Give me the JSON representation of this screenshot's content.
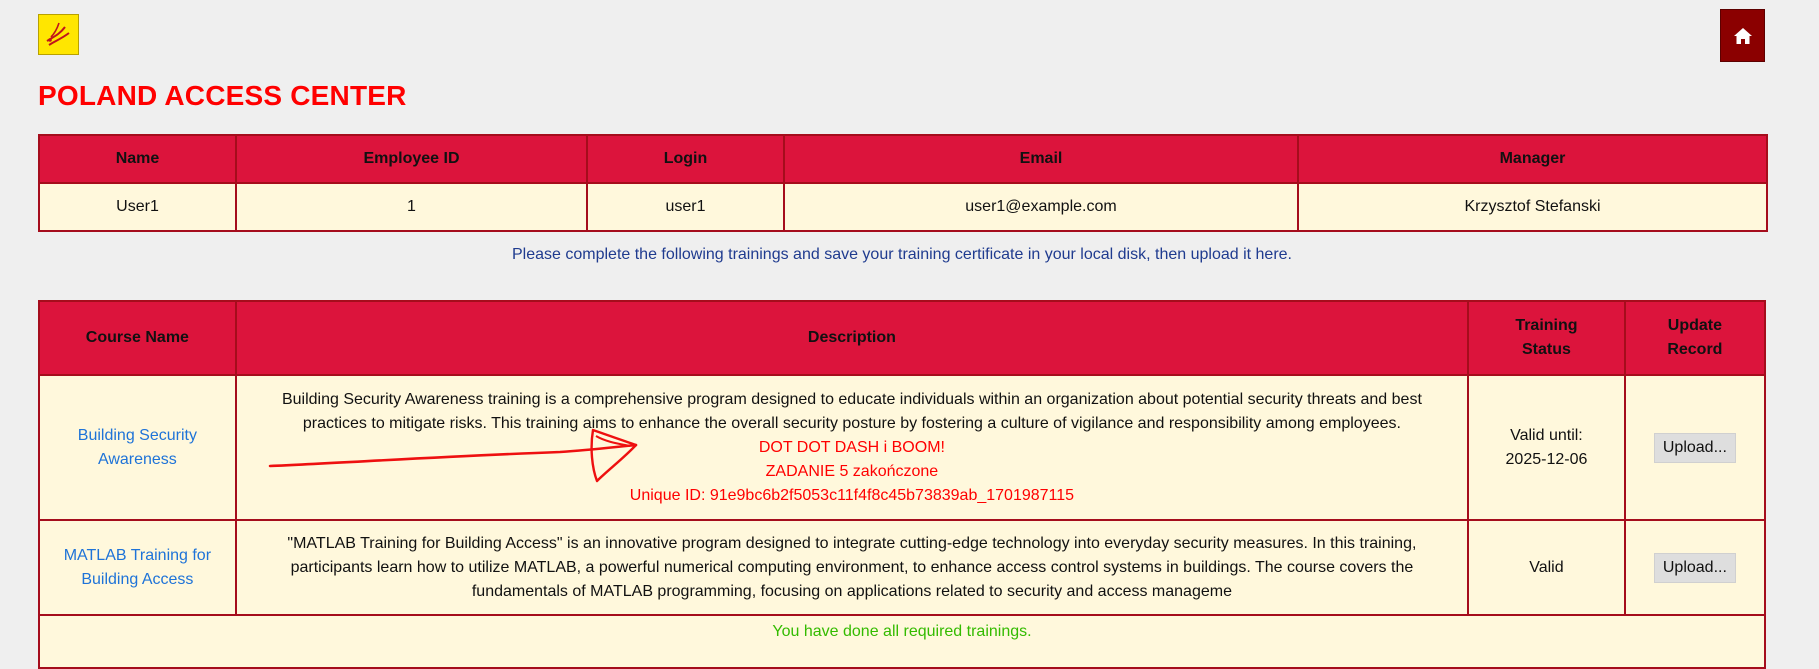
{
  "header": {
    "title": "POLAND ACCESS CENTER",
    "logo_icon": "bird-logo-icon",
    "home_icon": "home-icon"
  },
  "user_table": {
    "columns": [
      "Name",
      "Employee ID",
      "Login",
      "Email",
      "Manager"
    ],
    "row": {
      "name": "User1",
      "employee_id": "1",
      "login": "user1",
      "email": "user1@example.com",
      "manager": "Krzysztof Stefanski"
    }
  },
  "instruction": "Please complete the following trainings and save your training certificate in your local disk, then upload it here.",
  "course_table": {
    "columns": [
      "Course Name",
      "Description",
      "Training Status",
      "Update Record"
    ],
    "rows": [
      {
        "course_name": "Building Security Awareness",
        "description": "Building Security Awareness training is a comprehensive program designed to educate individuals within an organization about potential security threats and best practices to mitigate risks. This training aims to enhance the overall security posture by fostering a culture of vigilance and responsibility among employees.",
        "extra_lines": [
          "DOT DOT DASH i BOOM!",
          "ZADANIE 5 zakończone",
          "Unique ID: 91e9bc6b2f5053c11f4f8c45b73839ab_1701987115"
        ],
        "status": "Valid until: 2025-12-06",
        "upload_label": "Upload..."
      },
      {
        "course_name": "MATLAB Training for Building Access",
        "description": "\"MATLAB Training for Building Access\" is an innovative program designed to integrate cutting-edge technology into everyday security measures. In this training, participants learn how to utilize MATLAB, a powerful numerical computing environment, to enhance access control systems in buildings. The course covers the fundamentals of MATLAB programming, focusing on applications related to security and access manageme",
        "status": "Valid",
        "upload_label": "Upload..."
      }
    ],
    "summary": "You have done all required trainings."
  },
  "colors": {
    "accent_red": "#dc143c",
    "title_red": "#ff0000",
    "cell_bg": "#fff8dc",
    "status_green": "#33bb00",
    "link_blue": "#1e73d8",
    "home_button": "#8b0000"
  }
}
